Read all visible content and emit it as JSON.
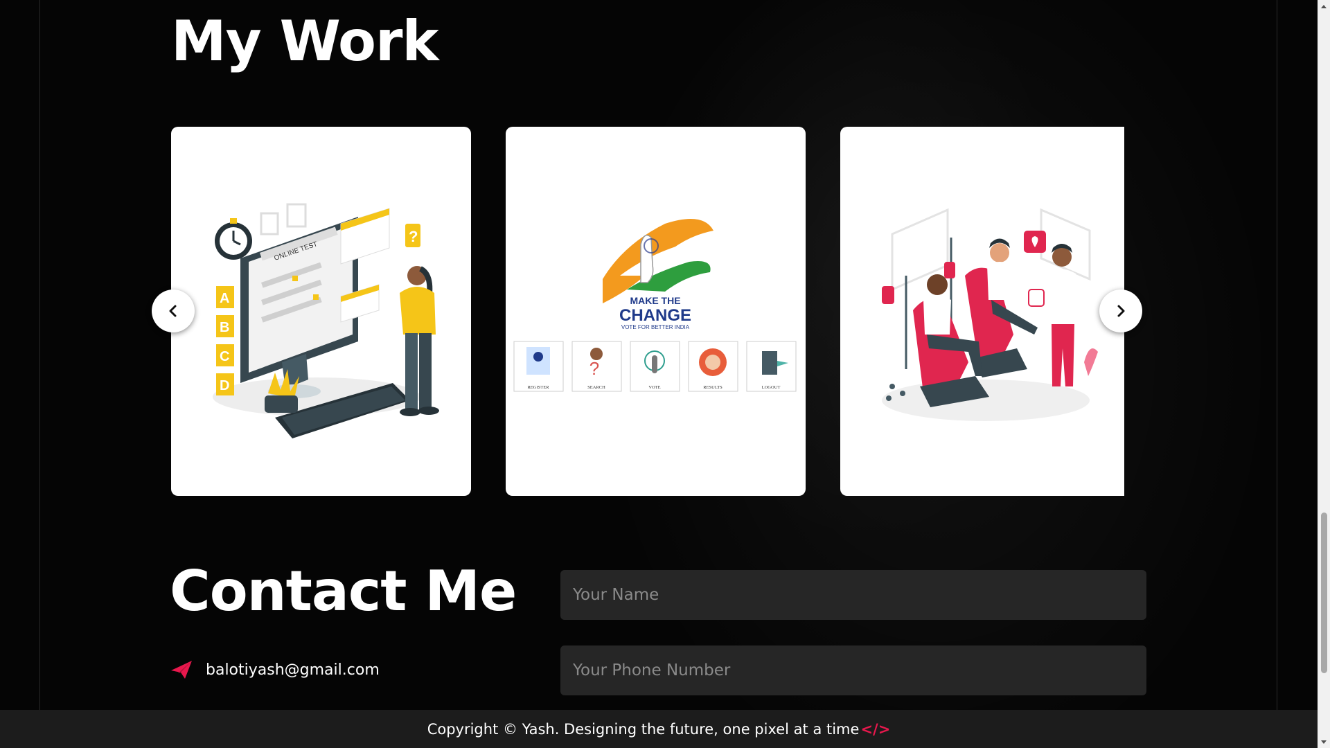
{
  "work": {
    "title": "My Work",
    "projects": [
      {
        "name": "online-test-illustration",
        "caption": "ONLINE TEST",
        "options": [
          "A",
          "B",
          "C",
          "D"
        ]
      },
      {
        "name": "make-the-change-voting",
        "headline1": "MAKE THE",
        "headline2": "CHANGE",
        "tagline": "VOTE FOR BETTER INDIA",
        "tiles": [
          "REGISTER",
          "SEARCH",
          "VOTE",
          "RESULTS",
          "LOGOUT"
        ]
      },
      {
        "name": "blood-donation-illustration"
      }
    ],
    "prev_icon": "chevron-left-icon",
    "next_icon": "chevron-right-icon"
  },
  "contact": {
    "title": "Contact Me",
    "email": "balotiyash@gmail.com",
    "email_icon": "paper-plane-icon",
    "name_placeholder": "Your Name",
    "phone_placeholder": "Your Phone Number"
  },
  "footer": {
    "text": "Copyright © Yash. Designing the future, one pixel at a time",
    "code_tag": "</>"
  },
  "colors": {
    "accent": "#e8184d",
    "background": "#050505",
    "input_bg": "#262626",
    "footer_bg": "#1c1c1c"
  }
}
